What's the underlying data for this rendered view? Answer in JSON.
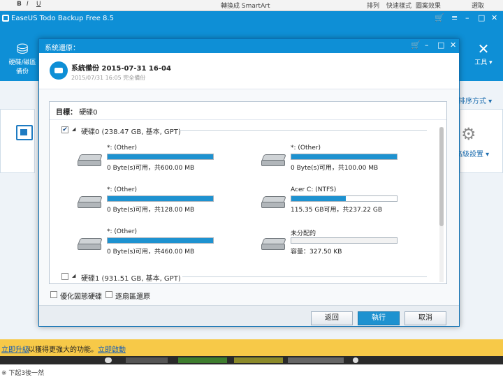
{
  "ribbon": {
    "bold": "B",
    "italic": "I",
    "underline": "U",
    "smartart": "轉換成 SmartArt",
    "arrange": "排列",
    "quick_styles": "快速樣式",
    "shape_effects": "圖案效果",
    "select": "選取"
  },
  "app": {
    "title": "EaseUS Todo Backup Free 8.5",
    "toolbar": {
      "disk_backup": "硬碟/磁區備份",
      "tools": "工具"
    },
    "sort_label": "排序方式",
    "advanced_settings": "高級設置",
    "upgrade_link": "立即升級",
    "upgrade_text": "以獲得更強大的功能。",
    "activate_link": "立即啟動",
    "bottom_text": "※ 下起3後一然"
  },
  "dialog": {
    "title": "系統還原：",
    "backup_name": "系統備份 2015-07-31 16-04",
    "backup_sub": "2015/07/31 16:05 完全備份",
    "target_label": "目標：",
    "target_value": "硬碟0",
    "disk0_label": "硬碟0 (238.47 GB, 基本, GPT)",
    "disk1_label": "硬碟1 (931.51 GB, 基本, GPT)",
    "disk0_checked": "✔",
    "partitions": [
      {
        "name": "*: (Other)",
        "info": "0 Byte(s)可用，共600.00 MB",
        "fill": 1.0
      },
      {
        "name": "*: (Other)",
        "info": "0 Byte(s)可用，共100.00 MB",
        "fill": 1.0
      },
      {
        "name": "*: (Other)",
        "info": "0 Byte(s)可用，共128.00 MB",
        "fill": 1.0
      },
      {
        "name": "Acer C: (NTFS)",
        "info": "115.35 GB可用，共237.22 GB",
        "fill": 0.514
      },
      {
        "name": "*: (Other)",
        "info": "0 Byte(s)可用，共460.00 MB",
        "fill": 1.0
      },
      {
        "name": "未分配的",
        "info": "容量：327.50 KB",
        "fill": 0.0
      }
    ],
    "opt_ssd": "優化固態硬碟",
    "opt_sector": "逐扇區還原",
    "btn_back": "返回",
    "btn_run": "執行",
    "btn_cancel": "取消"
  },
  "colors": {
    "brand": "#0e8fd6",
    "bar_fill": "#1e92d0",
    "upgrade_bar": "#f7c948"
  }
}
